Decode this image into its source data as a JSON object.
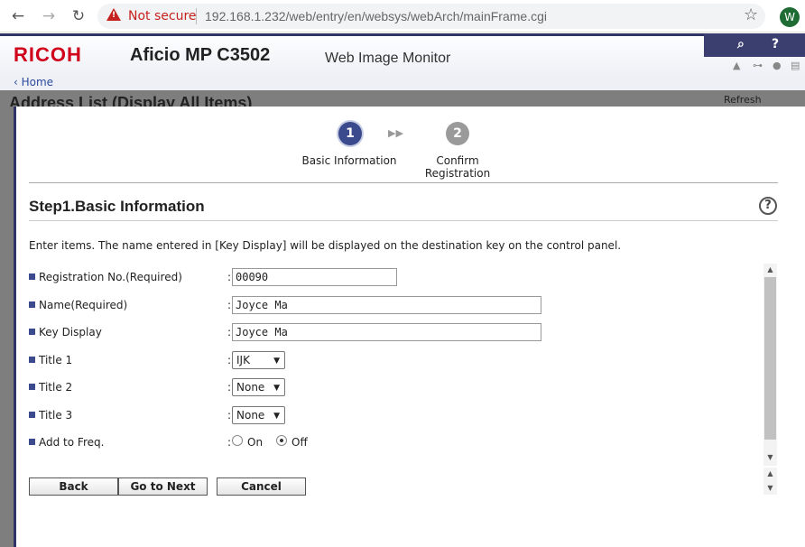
{
  "browser": {
    "security_label": "Not secure",
    "url": "192.168.1.232/web/entry/en/websys/webArch/mainFrame.cgi",
    "profile_initial": "W"
  },
  "header": {
    "brand": "RICOH",
    "model": "Aficio MP C3502",
    "app_name": "Web Image Monitor"
  },
  "breadcrumb": {
    "home": "Home"
  },
  "background_page": {
    "title": "Address List (Display All Items)",
    "refresh_label": "Refresh"
  },
  "wizard": {
    "steps": [
      {
        "number": "1",
        "label": "Basic Information",
        "active": true
      },
      {
        "number": "2",
        "label_line1": "Confirm",
        "label_line2": "Registration",
        "active": false
      }
    ]
  },
  "section": {
    "title": "Step1.Basic Information",
    "instructions": "Enter items. The name entered in [Key Display] will be displayed on the destination key on the control panel."
  },
  "form": {
    "registration_no": {
      "label": "Registration No.(Required)",
      "value": "00090"
    },
    "name": {
      "label": "Name(Required)",
      "value": "Joyce Ma"
    },
    "key_display": {
      "label": "Key Display",
      "value": "Joyce Ma"
    },
    "title1": {
      "label": "Title 1",
      "value": "IJK"
    },
    "title2": {
      "label": "Title 2",
      "value": "None"
    },
    "title3": {
      "label": "Title 3",
      "value": "None"
    },
    "add_to_freq": {
      "label": "Add to Freq.",
      "on_label": "On",
      "off_label": "Off",
      "selected": "Off"
    }
  },
  "buttons": {
    "back": "Back",
    "next": "Go to Next",
    "cancel": "Cancel"
  },
  "colors": {
    "brand_red": "#d0021b",
    "accent_navy": "#3b4a8c"
  }
}
